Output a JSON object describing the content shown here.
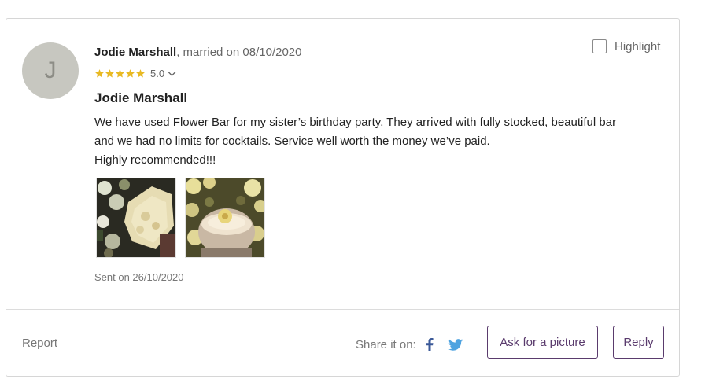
{
  "review": {
    "avatar_initial": "J",
    "author": "Jodie Marshall",
    "married_text": ", married on 08/10/2020",
    "rating": {
      "stars": 5,
      "value": "5.0",
      "star_color": "#e8b923",
      "dropdown_icon": "chevron-down-icon"
    },
    "title": "Jodie Marshall",
    "text_lines": [
      "We have used Flower Bar for my sister’s birthday party. They arrived with fully stocked, beautiful bar",
      "and we had no limits for cocktails. Service well worth the money we’ve paid.",
      "Highly recommended!!!"
    ],
    "photos": [
      {
        "icon": "flower-wall-photo"
      },
      {
        "icon": "cocktail-photo"
      }
    ],
    "sent": "Sent on 26/10/2020",
    "highlight_label": "Highlight",
    "highlight_checked": false
  },
  "footer": {
    "report_label": "Report",
    "share_label": "Share it on:",
    "share_icons": [
      "facebook-icon",
      "twitter-icon"
    ],
    "ask_picture_label": "Ask for a picture",
    "reply_label": "Reply"
  },
  "colors": {
    "accent": "#5a3b6d",
    "star": "#e8b923",
    "facebook": "#3b5998",
    "twitter": "#4fa3e0",
    "avatar_bg": "#c7c7c0"
  }
}
